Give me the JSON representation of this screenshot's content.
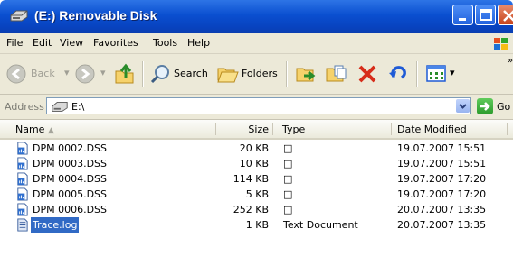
{
  "window": {
    "title": "(E:) Removable Disk"
  },
  "menu": [
    "File",
    "Edit",
    "View",
    "Favorites",
    "Tools",
    "Help"
  ],
  "toolbar": {
    "back": "Back",
    "search": "Search",
    "folders": "Folders"
  },
  "address": {
    "label": "Address",
    "value": "E:\\",
    "go": "Go"
  },
  "columns": {
    "name": "Name",
    "size": "Size",
    "type": "Type",
    "date": "Date Modified"
  },
  "files": [
    {
      "name": "DPM 0002.DSS",
      "size": "20 KB",
      "type": "□",
      "date": "19.07.2007 15:51",
      "icon": "audio-file-icon"
    },
    {
      "name": "DPM 0003.DSS",
      "size": "10 KB",
      "type": "□",
      "date": "19.07.2007 15:51",
      "icon": "audio-file-icon"
    },
    {
      "name": "DPM 0004.DSS",
      "size": "114 KB",
      "type": "□",
      "date": "19.07.2007 17:20",
      "icon": "audio-file-icon"
    },
    {
      "name": "DPM 0005.DSS",
      "size": "5 KB",
      "type": "□",
      "date": "19.07.2007 17:20",
      "icon": "audio-file-icon"
    },
    {
      "name": "DPM 0006.DSS",
      "size": "252 KB",
      "type": "□",
      "date": "20.07.2007 13:35",
      "icon": "audio-file-icon"
    },
    {
      "name": "Trace.log",
      "size": "1 KB",
      "type": "Text Document",
      "date": "20.07.2007 13:35",
      "icon": "text-file-icon",
      "selected": true
    }
  ],
  "colors": {
    "title_blue": "#0a4fd0",
    "selection": "#316ac5",
    "chrome": "#ece9d8"
  }
}
